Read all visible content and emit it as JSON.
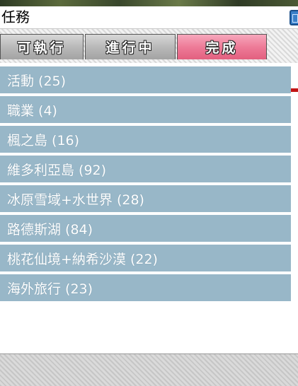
{
  "window": {
    "title": "任務"
  },
  "tabs": [
    {
      "label": "可執行",
      "active": false
    },
    {
      "label": "進行中",
      "active": false
    },
    {
      "label": "完成",
      "active": true
    }
  ],
  "categories": [
    {
      "label": "活動 (25)"
    },
    {
      "label": "職業 (4)"
    },
    {
      "label": "楓之島 (16)"
    },
    {
      "label": "維多利亞島 (92)"
    },
    {
      "label": "冰原雪域+水世界 (28)"
    },
    {
      "label": "路德斯湖 (84)"
    },
    {
      "label": "桃花仙境+納希沙漠 (22)"
    },
    {
      "label": "海外旅行 (23)"
    }
  ],
  "colors": {
    "active_tab": "#ee7b98",
    "list_item": "#98b7c8",
    "tab_underline": "#c31414"
  }
}
